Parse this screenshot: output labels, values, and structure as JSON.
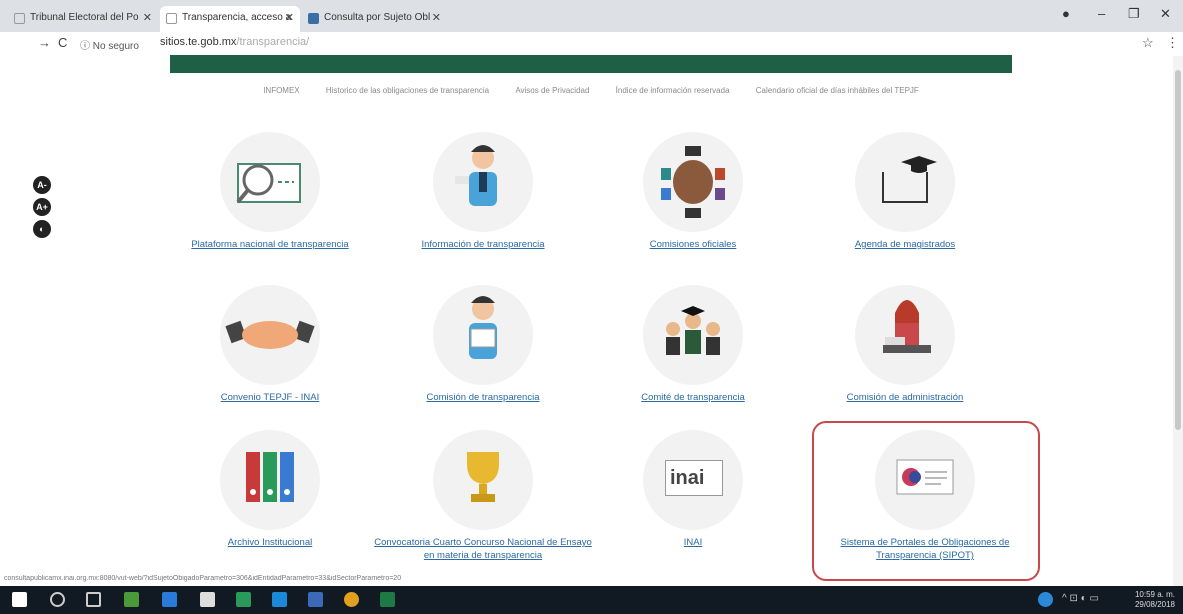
{
  "browser": {
    "tabs": [
      {
        "title": "Tribunal Electoral del Po"
      },
      {
        "title": "Transparencia, acceso a"
      },
      {
        "title": "Consulta por Sujeto Obl"
      }
    ],
    "security_label": "No seguro",
    "url_host": "sitios.te.gob.mx",
    "url_path": "/transparencia/"
  },
  "top_menu": [
    "INFOMEX",
    "Historico de las obligaciones de transparencia",
    "Avisos de Privacidad",
    "Índice de información reservada",
    "Calendario oficial de días inhábiles del TEPJF"
  ],
  "accessibility": {
    "decrease": "A-",
    "increase": "A+",
    "contrast": "◐"
  },
  "tiles": [
    {
      "label": "Plataforma nacional de transparencia",
      "icon": "monitor-magnifier-icon"
    },
    {
      "label": "Información de transparencia",
      "icon": "businessman-icon"
    },
    {
      "label": "Comisiones oficiales",
      "icon": "meeting-table-icon"
    },
    {
      "label": "Agenda de magistrados",
      "icon": "graduation-cap-icon"
    },
    {
      "label": "Convenio TEPJF - INAI",
      "icon": "handshake-icon"
    },
    {
      "label": "Comisión de transparencia",
      "icon": "man-reading-icon"
    },
    {
      "label": "Comité de transparencia",
      "icon": "committee-icon"
    },
    {
      "label": "Comisión de administración",
      "icon": "woman-desk-icon"
    },
    {
      "label": "Archivo Institucional",
      "icon": "binders-icon"
    },
    {
      "label": "Convocatoria Cuarto Concurso Nacional de Ensayo en materia de transparencia",
      "icon": "trophy-icon"
    },
    {
      "label": "INAI",
      "icon": "inai-logo-icon"
    },
    {
      "label": "Sistema de Portales de Obligaciones de Transparencia (SIPOT)",
      "icon": "sipot-logo-icon"
    }
  ],
  "inai_logo_text": "inai",
  "status_url": "consultapublicamx.inai.org.mx:8080/vut-web/?idSujetoObigadoParametro=306&idEntidadParametro=33&idSectorParametro=20",
  "clock": {
    "time": "10:59 a. m.",
    "date": "29/08/2018"
  },
  "colors": {
    "header_green": "#1f5f46",
    "link_blue": "#2b6aa3",
    "highlight_red": "#c8484c"
  }
}
